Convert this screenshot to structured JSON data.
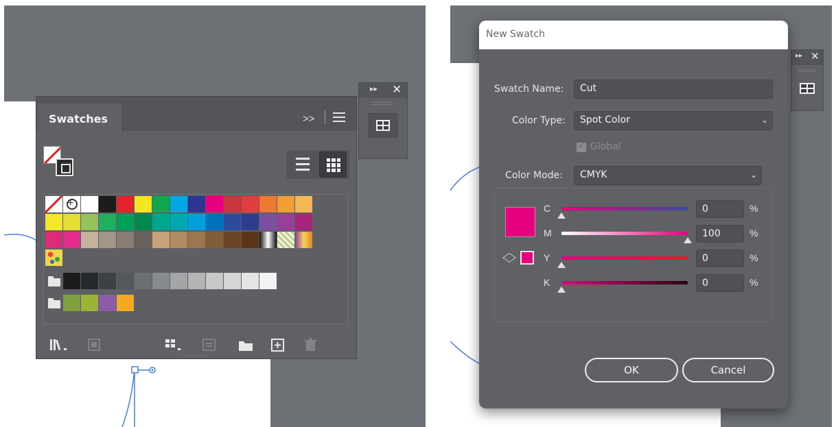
{
  "left": {
    "dock_controls": {
      "expand": "▸▸",
      "close": "✕"
    },
    "panel": {
      "tab_label": "Swatches",
      "expand_glyph": ">>",
      "swatch_rows": [
        [
          "none",
          "reg",
          "#ffffff",
          "#1c1c1c",
          "#e4232a",
          "#f6e622",
          "#10a84f",
          "#00a8e1",
          "#2d3590",
          "#e6007e",
          "#c8353d",
          "#e33e3d",
          "#ec7a30",
          "#f19e34",
          "#f6b755"
        ],
        [
          "#f5e62a",
          "#e5dc34",
          "#95c35a",
          "#1fb05e",
          "#00a057",
          "#00894f",
          "#00a78f",
          "#00a6b0",
          "#009fdc",
          "#0072b9",
          "#2e4b9b",
          "#2d3c8b",
          "#7c4f9f",
          "#993f98",
          "#a9247d"
        ],
        [
          "#db2b7a",
          "#e32b8c",
          "#c6b19a",
          "#a39587",
          "#8a7c70",
          "#6a625a",
          "#c9a27a",
          "#b08a62",
          "#9b7650",
          "#7f5c3a",
          "#6b4425",
          "#5a3519",
          "grad-bw",
          "pattern-dots",
          "grad-gold"
        ],
        [
          "pattern"
        ]
      ],
      "gray_group": [
        "#1c1c1c",
        "#26292b",
        "#3e4144",
        "#55585b",
        "#6d7073",
        "#888b8e",
        "#a3a5a7",
        "#b2b4b6",
        "#c6c8ca",
        "#d5d6d8",
        "#e4e5e6",
        "#f3f3f4"
      ],
      "color_group": [
        "#7ea03c",
        "#9ab535",
        "#8d5ca8",
        "#f6a823"
      ]
    }
  },
  "right": {
    "dialog": {
      "title": "New Swatch",
      "swatch_name_label": "Swatch Name:",
      "swatch_name_value": "Cut",
      "color_type_label": "Color Type:",
      "color_type_value": "Spot Color",
      "global_label": "Global",
      "color_mode_label": "Color Mode:",
      "color_mode_value": "CMYK",
      "sliders": [
        {
          "letter": "C",
          "value": "0",
          "unit": "%",
          "fraction": 0.0
        },
        {
          "letter": "M",
          "value": "100",
          "unit": "%",
          "fraction": 1.0
        },
        {
          "letter": "Y",
          "value": "0",
          "unit": "%",
          "fraction": 0.0
        },
        {
          "letter": "K",
          "value": "0",
          "unit": "%",
          "fraction": 0.0
        }
      ],
      "ok_label": "OK",
      "cancel_label": "Cancel",
      "swatch_color": "#e6007e"
    }
  }
}
